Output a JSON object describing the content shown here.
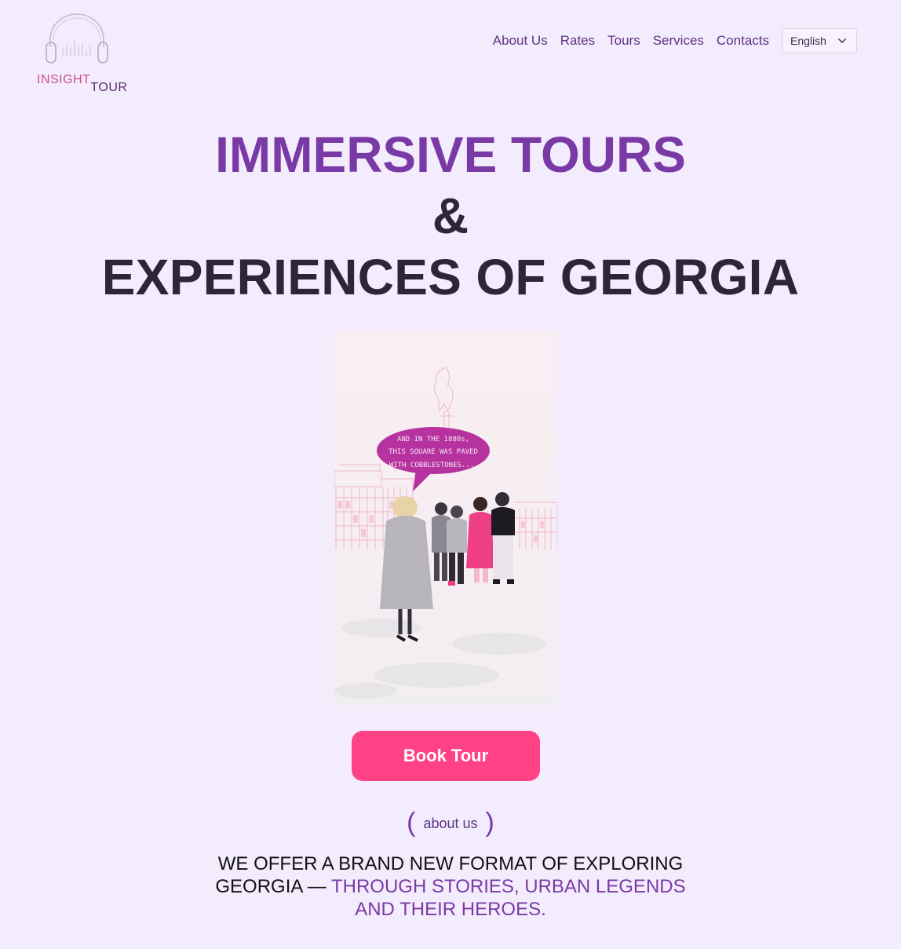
{
  "brand": {
    "logo_part1": "INSIGHT",
    "logo_part2": "TOUR",
    "logo_icon": "headphones-icon",
    "colors": {
      "pink": "#d14d8a",
      "purple": "#5a2d6e"
    }
  },
  "nav": {
    "items": [
      {
        "label": "About Us"
      },
      {
        "label": "Rates"
      },
      {
        "label": "Tours"
      },
      {
        "label": "Services"
      },
      {
        "label": "Contacts"
      }
    ],
    "language": {
      "selected": "English",
      "icon": "chevron-down-icon"
    }
  },
  "hero": {
    "line1": "IMMERSIVE TOURS",
    "line2": "&",
    "line3": "EXPERIENCES OF GEORGIA"
  },
  "illustration": {
    "speech_line1": "AND IN THE 1880s,",
    "speech_line2": "THIS SQUARE WAS PAVED",
    "speech_line3": "WITH COBBLESTONES..."
  },
  "cta": {
    "book_label": "Book Tour"
  },
  "about": {
    "tag": "about us",
    "offer_line1": "WE OFFER A BRAND NEW FORMAT OF EXPLORING",
    "offer_line2_plain": "GEORGIA — ",
    "offer_line2_accent": "THROUGH STORIES, URBAN LEGENDS",
    "offer_line3_accent": "AND THEIR HEROES."
  },
  "colors": {
    "background": "#f3ecfc",
    "accent_purple": "#7a3aa6",
    "button_pink": "#ff4286",
    "heading_dark": "#2d2638"
  }
}
